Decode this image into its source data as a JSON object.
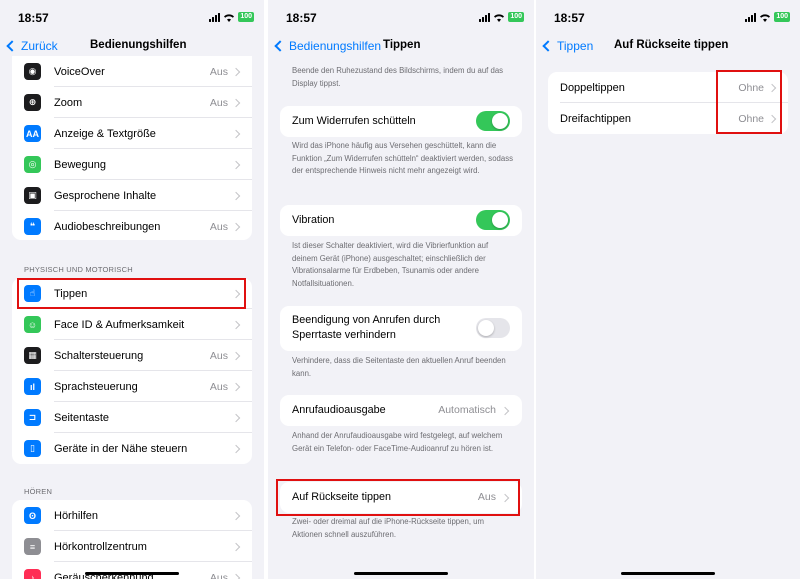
{
  "status": {
    "time": "18:57",
    "battery": "100"
  },
  "screen1": {
    "back": "Zurück",
    "title": "Bedienungshilfen",
    "group1": [
      {
        "label": "VoiceOver",
        "value": "Aus",
        "icon": "voiceover-icon",
        "color": "#1c1c1e"
      },
      {
        "label": "Zoom",
        "value": "Aus",
        "icon": "zoom-icon",
        "color": "#1c1c1e"
      },
      {
        "label": "Anzeige & Textgröße",
        "value": "",
        "icon": "text-size-icon",
        "color": "#007aff"
      },
      {
        "label": "Bewegung",
        "value": "",
        "icon": "motion-icon",
        "color": "#34c759"
      },
      {
        "label": "Gesprochene Inhalte",
        "value": "",
        "icon": "speech-icon",
        "color": "#1c1c1e"
      },
      {
        "label": "Audiobeschreibungen",
        "value": "Aus",
        "icon": "audio-description-icon",
        "color": "#007aff"
      }
    ],
    "section2": "PHYSISCH UND MOTORISCH",
    "group2": [
      {
        "label": "Tippen",
        "value": "",
        "icon": "touch-icon",
        "color": "#007aff"
      },
      {
        "label": "Face ID & Aufmerksamkeit",
        "value": "",
        "icon": "faceid-icon",
        "color": "#34c759"
      },
      {
        "label": "Schaltersteuerung",
        "value": "Aus",
        "icon": "switch-control-icon",
        "color": "#1c1c1e"
      },
      {
        "label": "Sprachsteuerung",
        "value": "Aus",
        "icon": "voice-control-icon",
        "color": "#007aff"
      },
      {
        "label": "Seitentaste",
        "value": "",
        "icon": "side-button-icon",
        "color": "#007aff"
      },
      {
        "label": "Geräte in der Nähe steuern",
        "value": "",
        "icon": "nearby-devices-icon",
        "color": "#007aff"
      }
    ],
    "section3": "HÖREN",
    "group3": [
      {
        "label": "Hörhilfen",
        "value": "",
        "icon": "hearing-aid-icon",
        "color": "#007aff"
      },
      {
        "label": "Hörkontrollzentrum",
        "value": "",
        "icon": "hearing-control-icon",
        "color": "#8e8e93"
      },
      {
        "label": "Geräuscherkennung",
        "value": "Aus",
        "icon": "sound-recognition-icon",
        "color": "#ff2d55"
      }
    ]
  },
  "screen2": {
    "back": "Bedienungshilfen",
    "title": "Tippen",
    "top_desc": "Beende den Ruhezustand des Bildschirms, indem du auf das Display tippst.",
    "shake_label": "Zum Widerrufen schütteln",
    "shake_on": true,
    "shake_desc": "Wird das iPhone häufig aus Versehen geschüttelt, kann die Funktion „Zum Widerrufen schütteln“ deaktiviert werden, sodass der entsprechende Hinweis nicht mehr angezeigt wird.",
    "vibration_label": "Vibration",
    "vibration_on": true,
    "vibration_desc": "Ist dieser Schalter deaktiviert, wird die Vibrierfunktion auf deinem Gerät (iPhone) ausgeschaltet; einschließlich der Vibrationsalarme für Erdbeben, Tsunamis oder andere Notfallsituationen.",
    "endcall_label_1": "Beendigung von Anrufen durch",
    "endcall_label_2": "Sperrtaste verhindern",
    "endcall_on": false,
    "endcall_desc": "Verhindere, dass die Seitentaste den aktuellen Anruf beenden kann.",
    "audio_label": "Anrufaudioausgabe",
    "audio_value": "Automatisch",
    "audio_desc": "Anhand der Anrufaudioausgabe wird festgelegt, auf welchem Gerät ein Telefon- oder FaceTime-Audioanruf zu hören ist.",
    "backtap_label": "Auf Rückseite tippen",
    "backtap_value": "Aus",
    "backtap_desc": "Zwei- oder dreimal auf die iPhone-Rückseite tippen, um Aktionen schnell auszuführen."
  },
  "screen3": {
    "back": "Tippen",
    "title": "Auf Rückseite tippen",
    "rows": [
      {
        "label": "Doppeltippen",
        "value": "Ohne"
      },
      {
        "label": "Dreifachtippen",
        "value": "Ohne"
      }
    ]
  },
  "colors": {
    "accent": "#007aff",
    "toggle_on": "#34c759",
    "highlight": "#e01010"
  }
}
